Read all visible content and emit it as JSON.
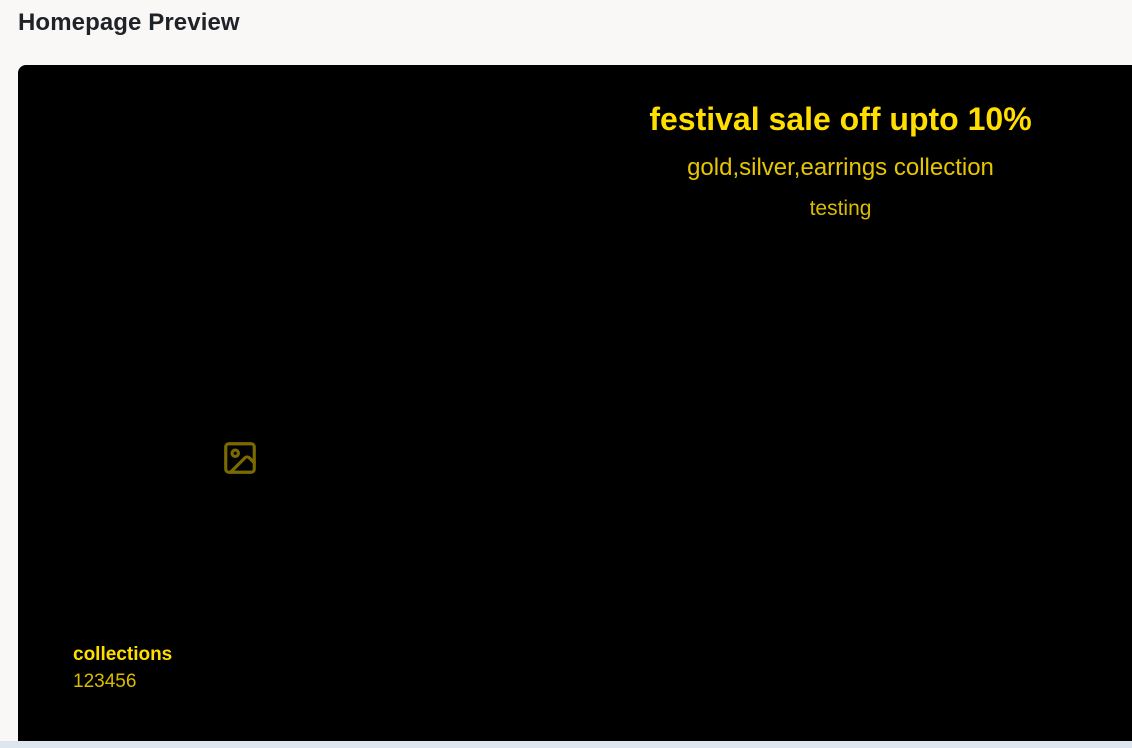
{
  "page": {
    "title": "Homepage Preview"
  },
  "hero": {
    "heading": "festival sale off upto 10%",
    "subheading": "gold,silver,earrings collection",
    "tagline": "testing",
    "heading_color": "#ffde00",
    "subheading_color": "#e6c600",
    "tagline_color": "#d9bc00"
  },
  "media": {
    "icon": "image-placeholder-icon",
    "icon_color": "#7a6a00"
  },
  "collection": {
    "title": "collections",
    "code": "123456",
    "title_color": "#ffde00",
    "code_color": "#d9bc00"
  },
  "theme": {
    "background": "#000000",
    "page_background": "#f9f8f6"
  }
}
